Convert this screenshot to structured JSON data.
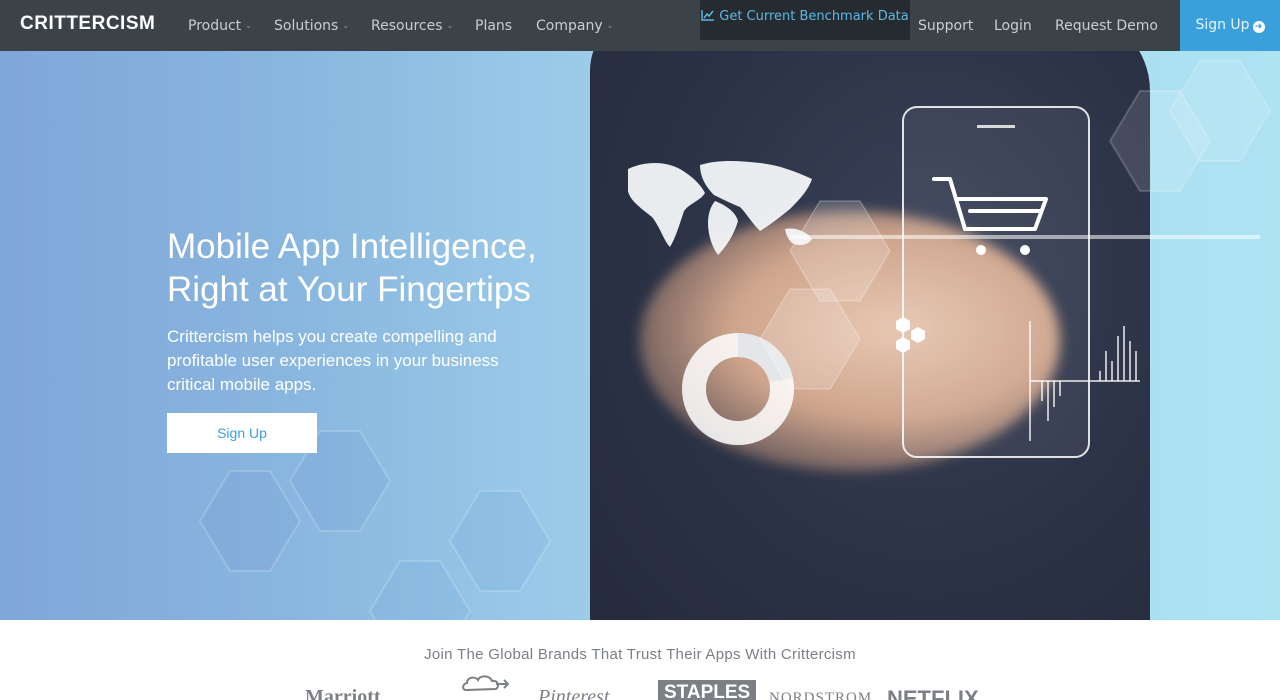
{
  "nav": {
    "logo": "CRITTERCISM",
    "items": [
      {
        "label": "Product",
        "dropdown": true
      },
      {
        "label": "Solutions",
        "dropdown": true
      },
      {
        "label": "Resources",
        "dropdown": true
      },
      {
        "label": "Plans",
        "dropdown": false
      },
      {
        "label": "Company",
        "dropdown": true
      }
    ],
    "benchmark_label": "Get Current Benchmark Data",
    "right_items": [
      "Support",
      "Login",
      "Request Demo"
    ],
    "signup_label": "Sign Up"
  },
  "hero": {
    "title": "Mobile App Intelligence, Right at Your Fingertips",
    "subtitle": "Crittercism helps you create compelling and profitable user experiences in your business critical mobile apps.",
    "cta_label": "Sign Up"
  },
  "brands": {
    "title": "Join The Global Brands That Trust Their Apps With Crittercism",
    "logos": [
      "Marriott",
      "Pinterest",
      "STAPLES",
      "NORDSTROM",
      "NETFLIX"
    ]
  },
  "colors": {
    "nav_bg": "#3b4248",
    "accent": "#3aa0dc",
    "benchmark_bg": "#262b30"
  },
  "icons": {
    "benchmark": "line-chart-icon",
    "signup": "arrow-circle-right-icon",
    "caret": "chevron-down-icon"
  }
}
